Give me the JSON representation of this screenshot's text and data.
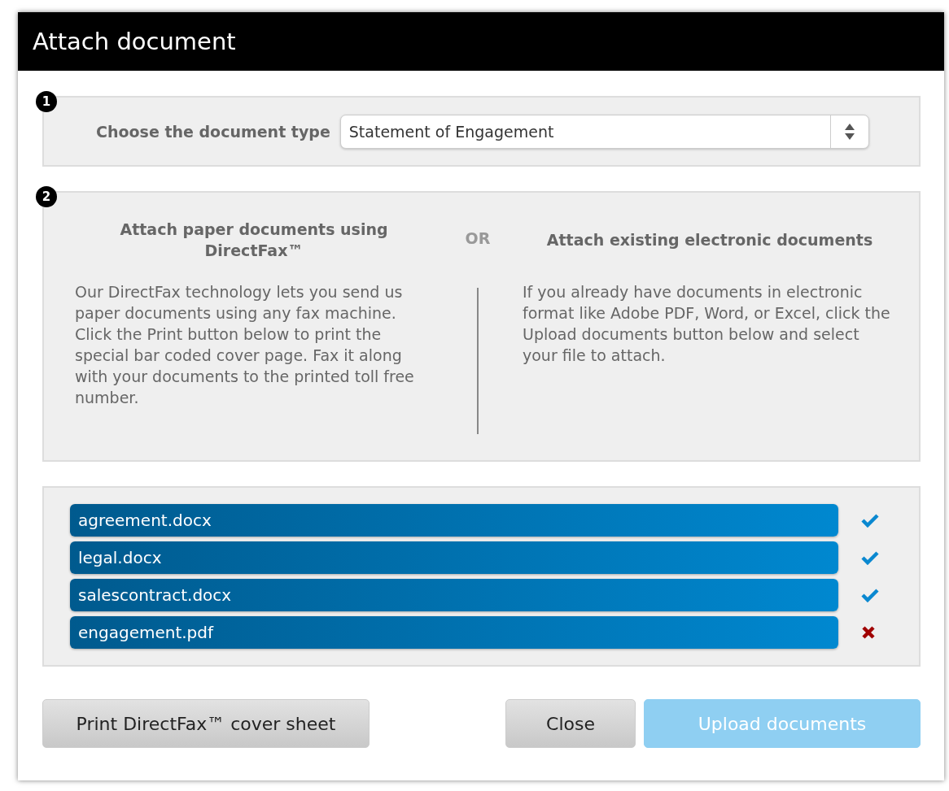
{
  "window": {
    "title": "Attach document"
  },
  "step_1": {
    "number": "1",
    "label": "Choose the document type",
    "select_value": "Statement of Engagement"
  },
  "step_2": {
    "number": "2",
    "left_heading": "Attach paper documents using DirectFax™",
    "or_label": "OR",
    "right_heading": "Attach existing electronic documents",
    "left_text": "Our DirectFax technology lets you send us paper documents using any fax machine. Click the Print button below to print the special bar coded cover page. Fax it along with your documents to the printed toll free number.",
    "right_text": "If you already have documents in electronic format like Adobe PDF, Word, or Excel, click the Upload documents button below and select your file to attach."
  },
  "files": [
    {
      "name": "agreement.docx",
      "uploaded": true
    },
    {
      "name": "legal.docx",
      "uploaded": true
    },
    {
      "name": "salescontract.docx",
      "uploaded": true
    },
    {
      "name": "engagement.pdf",
      "uploaded": false
    }
  ],
  "buttons": {
    "print": "Print DirectFax™ cover sheet",
    "close": "Close",
    "upload": {
      "label": "Upload documents",
      "disabled": true
    }
  }
}
